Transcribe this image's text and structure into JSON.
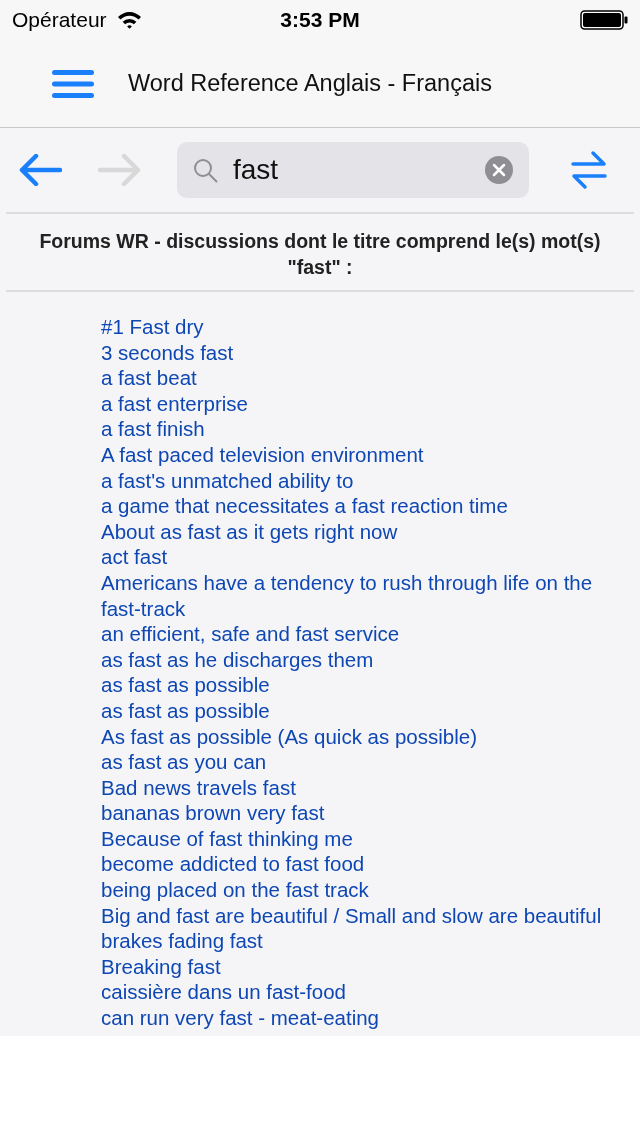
{
  "status_bar": {
    "carrier": "Opérateur",
    "time": "3:53 PM"
  },
  "nav_bar": {
    "title": "Word Reference Anglais - Français"
  },
  "toolbar": {
    "back": {
      "disabled": false
    },
    "forward": {
      "disabled": true
    },
    "search": {
      "value": "fast"
    }
  },
  "heading": "Forums WR - discussions dont le titre comprend le(s) mot(s) \"fast\" :",
  "results": [
    "#1 Fast dry",
    "3 seconds fast",
    "a fast beat",
    "a fast enterprise",
    "a fast finish",
    "A fast paced television environment",
    "a fast's unmatched ability to",
    "a game that necessitates a fast reaction time",
    "About as fast as it gets right now",
    "act fast",
    "Americans have a tendency to rush through life on the fast-track",
    "an efficient, safe and fast service",
    "as fast as he discharges them",
    "as fast as possible",
    "as fast as possible",
    "As fast as possible (As quick as possible)",
    "as fast as you can",
    "Bad news travels fast",
    "bananas brown very fast",
    "Because of fast thinking me",
    "become addicted to fast food",
    "being placed on the fast track",
    "Big and fast are beautiful / Small and slow are beautiful",
    "brakes fading fast",
    "Breaking fast",
    "caissière dans un fast-food",
    "can run very fast - meat-eating"
  ]
}
